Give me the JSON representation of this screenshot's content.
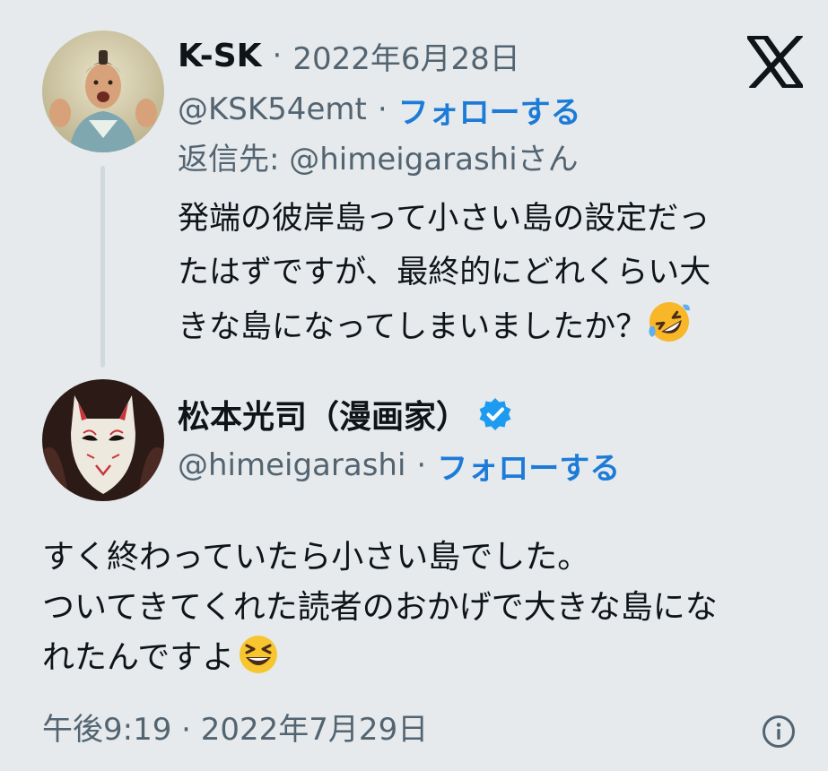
{
  "brand": {
    "logo_icon": "x-logo-icon"
  },
  "reply_tweet": {
    "author_name": "K-SK",
    "separator": "·",
    "date": "2022年6月28日",
    "handle": "@KSK54emt",
    "follow_label": "フォローする",
    "reply_to": "返信先: @himeigarashiさん",
    "text_lines": [
      "発端の彼岸島って小さい島の設定だっ",
      "たはずですが、最終的にどれくらい大",
      "きな島になってしまいましたか？"
    ],
    "emoji": "rolling-on-the-floor-laughing-emoji"
  },
  "main_tweet": {
    "author_name": "松本光司（漫画家）",
    "verified_icon": "verified-badge-icon",
    "handle": "@himeigarashi",
    "separator": "·",
    "follow_label": "フォローする",
    "text_lines": [
      "すく終わっていたら小さい島でした。",
      "ついてきてくれた読者のおかげで大きな島にな",
      "れたんですよ"
    ],
    "emoji": "grinning-squinting-face-emoji",
    "timestamp": "午後9:19 · 2022年7月29日",
    "info_icon": "info-icon"
  },
  "colors": {
    "background": "#e6eaed",
    "link": "#1d7bd8",
    "verified": "#1d9bf0",
    "muted": "#536471"
  }
}
